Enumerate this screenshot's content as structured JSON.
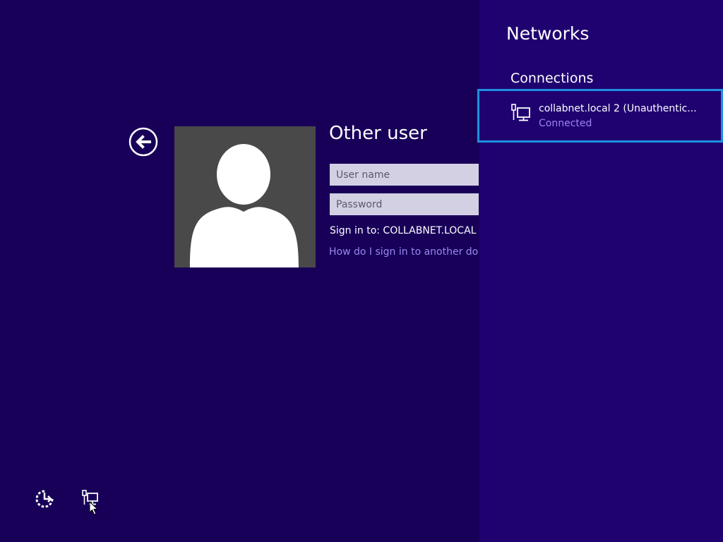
{
  "login": {
    "back_icon": "back-arrow-icon",
    "avatar_icon": "user-silhouette-icon",
    "title": "Other user",
    "username_placeholder": "User name",
    "password_placeholder": "Password",
    "sign_in_to": "Sign in to: COLLABNET.LOCAL",
    "help_link": "How do I sign in to another domain?"
  },
  "bottom_icons": {
    "ease_of_access_icon": "ease-of-access-icon",
    "network_icon": "wired-network-icon"
  },
  "networks": {
    "title": "Networks",
    "section": "Connections",
    "connections": [
      {
        "name": "collabnet.local  2 (Unauthentic...",
        "status": "Connected",
        "icon": "wired-network-icon"
      }
    ]
  },
  "colors": {
    "background": "#180059",
    "flyout_background": "#1f0270",
    "selection_border": "#1e90e0",
    "link": "#9b86f0",
    "avatar_background": "#494949"
  }
}
